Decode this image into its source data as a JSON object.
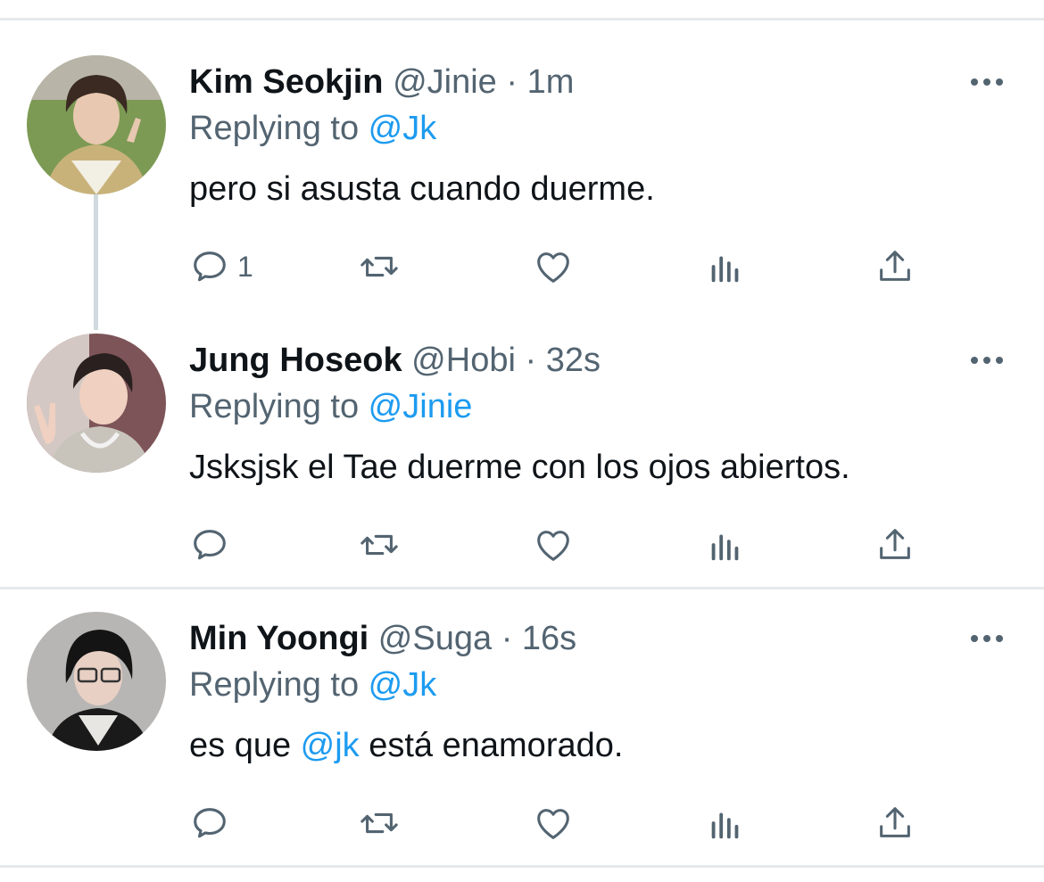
{
  "tweets": [
    {
      "name": "Kim Seokjin",
      "handle": "@Jinie",
      "dot": "·",
      "time": "1m",
      "replying_prefix": "Replying to ",
      "replying_to": "@Jk",
      "text_parts": [
        "pero si asusta cuando duerme."
      ],
      "reply_count": "1",
      "avatar_colors": {
        "bg": "#6d8a4a",
        "skin": "#e8c8b0",
        "hair": "#3a2a22",
        "shirt": "#c9b27a"
      }
    },
    {
      "name": "Jung Hoseok",
      "handle": "@Hobi",
      "dot": "·",
      "time": "32s",
      "replying_prefix": "Replying to ",
      "replying_to": "@Jinie",
      "text_parts": [
        "Jsksjsk el Tae duerme con los ojos abiertos."
      ],
      "reply_count": "",
      "avatar_colors": {
        "bg": "#8a5a5a",
        "skin": "#f0d0c0",
        "hair": "#2a2020",
        "shirt": "#c8c4bc"
      }
    },
    {
      "name": "Min Yoongi",
      "handle": "@Suga",
      "dot": "·",
      "time": "16s",
      "replying_prefix": "Replying to ",
      "replying_to": "@Jk",
      "text_parts": [
        "es que ",
        "@jk",
        " está enamorado."
      ],
      "reply_count": "",
      "avatar_colors": {
        "bg": "#b8b6b4",
        "skin": "#e8d0c4",
        "hair": "#141414",
        "shirt": "#1a1a1a"
      }
    }
  ],
  "icons": [
    "comment-icon",
    "retweet-icon",
    "like-icon",
    "views-icon",
    "share-icon",
    "more-icon"
  ],
  "colors": {
    "accent": "#1d9bf0",
    "secondary_text": "#536471",
    "icon": "#536471"
  }
}
